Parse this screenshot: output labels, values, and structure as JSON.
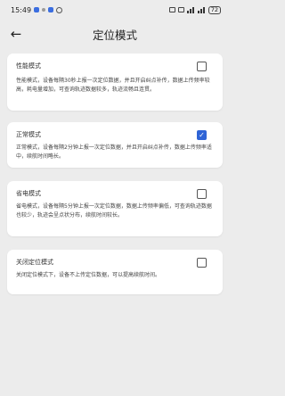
{
  "status_bar": {
    "time": "15:49",
    "battery": "72",
    "network_label": "4G"
  },
  "header": {
    "back_icon": "arrow-left-icon",
    "title": "定位模式"
  },
  "modes": [
    {
      "title": "性能模式",
      "description": "性能模式，设备每隔30秒上报一次定位数据，并且开启纠点补传，数据上传频率较高，耗电量增加，可查询轨迹数据较多，轨迹流畅且连贯。",
      "checked": false
    },
    {
      "title": "正常模式",
      "description": "正常模式，设备每隔2分钟上报一次定位数据，并且开启纠点补传，数据上传频率适中，续航时间略长。",
      "checked": true
    },
    {
      "title": "省电模式",
      "description": "省电模式，设备每隔5分钟上报一次定位数据，数据上传频率偏低，可查询轨迹数据也较少，轨迹会呈点状分布，续航时间较长。",
      "checked": false
    },
    {
      "title": "关闭定位模式",
      "description": "关闭定位模式下，设备不上传定位数据，可以提高续航时间。",
      "checked": false
    }
  ],
  "colors": {
    "accent": "#2f64d6",
    "background": "#ececec",
    "card": "#ffffff"
  }
}
